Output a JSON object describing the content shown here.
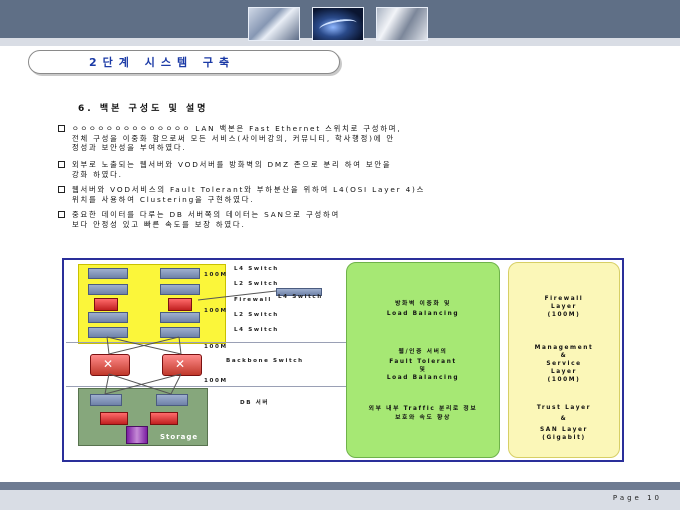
{
  "header": {
    "photos": [
      "photo-office",
      "photo-network-swirl",
      "photo-crowd"
    ]
  },
  "title": "2단계 시스템 구축",
  "section": "6. 백본 구성도 및 설명",
  "bullets": [
    {
      "l1": "ㅇㅇㅇㅇㅇㅇㅇㅇㅇㅇㅇㅇㅇㅇ LAN 백본은 Fast Ethernet 스위치로 구성하며,",
      "l2": "전체 구성을 이중화 함으로써 모든 서비스(사이버강의, 커뮤니티, 학사행정)에 안",
      "l3": "정성과 보안성을 부여하였다."
    },
    {
      "l1": "외부로 노출되는 웹서버와 VOD서버를 방화벽의 DMZ 존으로 분리 하여 보안을",
      "l2": "강화 하였다.",
      "l3": ""
    },
    {
      "l1": "웹서버와 VOD서비스의 Fault Tolerant와 부하분산을 위하여 L4(OSI Layer 4)스",
      "l2": "위치를 사용하여 Clustering을 구현하였다.",
      "l3": ""
    },
    {
      "l1": "중요한 데이터를 다루는 DB 서버쪽의 데이터는 SAN으로 구성하여",
      "l2": "보다 안정성 있고 빠른 속도를 보장 하였다.",
      "l3": ""
    }
  ],
  "diagram": {
    "labels": {
      "l4_top": "L4 Switch",
      "l2_top": "L2 Switch",
      "firewall": "Firewall",
      "l4_side": "L4 Switch",
      "l2_mid": "L2 Switch",
      "l4_bottom": "L4 Switch",
      "backbone": "Backbone Switch",
      "db": "DB 서버",
      "storage": "Storage",
      "speed1": "100M",
      "speed2": "100M",
      "speed3": "100M",
      "speed4": "100M"
    },
    "green_panel": {
      "b1_l1": "방화벽 이중화 및",
      "b1_l2": "Load Balancing",
      "b2_l1": "웹/인증 서버의",
      "b2_l2": "Fault Tolerant",
      "b2_l3": "및",
      "b2_l4": "Load Balancing",
      "b3_l1": "외부 내부 Traffic 분리로 정보",
      "b3_l2": "보호와 속도 향상"
    },
    "yellow_panel": {
      "b1_l1": "Firewall",
      "b1_l2": "Layer",
      "b1_l3": "(100M)",
      "b2_l1": "Management",
      "b2_l2": "&",
      "b2_l3": "Service",
      "b2_l4": "Layer",
      "b2_l5": "(100M)",
      "b3_l1": "Trust Layer",
      "b3_l2": "&",
      "b3_l3": "SAN Layer",
      "b3_l4": "(Gigabit)"
    },
    "colors": {
      "border": "#2a2f9a",
      "zone_dmz": "#fbf63a",
      "zone_db": "#86a77c",
      "panel_green": "#a6e874",
      "panel_yellow": "#fbf7b8"
    }
  },
  "footer": {
    "page": "Page 10"
  }
}
